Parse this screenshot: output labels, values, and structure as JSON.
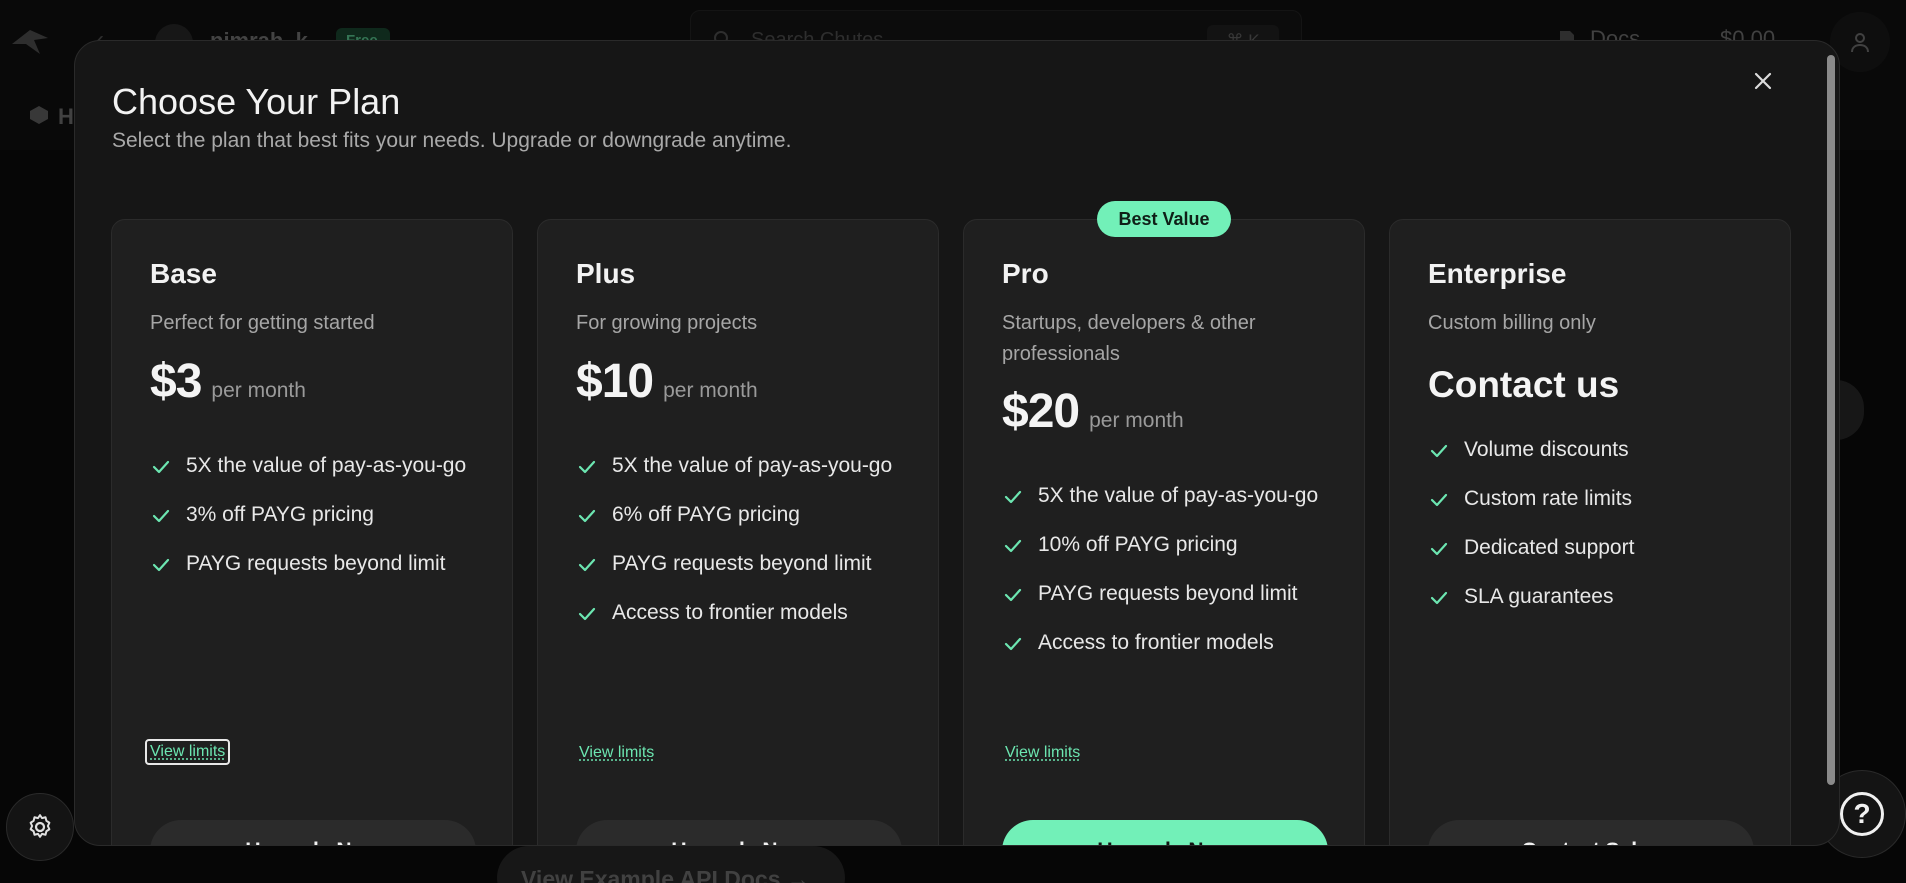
{
  "background": {
    "username": "nimrah_k",
    "plan_badge": "Free",
    "search_placeholder": "Search Chutes",
    "search_shortcut": "⌘ K",
    "docs_label": "Docs",
    "balance": "$0.00",
    "nav_label": "H",
    "bottom_button": "View Example API Docs →"
  },
  "modal": {
    "title": "Choose Your Plan",
    "subtitle": "Select the plan that best fits your needs. Upgrade or downgrade anytime.",
    "close_icon": "close-icon"
  },
  "badge": {
    "best_value": "Best Value"
  },
  "plans": [
    {
      "name": "Base",
      "description": "Perfect for getting started",
      "price": "$3",
      "period": "per month",
      "features": [
        "5X the value of pay-as-you-go",
        "3% off PAYG pricing",
        "PAYG requests beyond limit"
      ],
      "view_limits": "View limits",
      "cta": "Upgrade Now"
    },
    {
      "name": "Plus",
      "description": "For growing projects",
      "price": "$10",
      "period": "per month",
      "features": [
        "5X the value of pay-as-you-go",
        "6% off PAYG pricing",
        "PAYG requests beyond limit",
        "Access to frontier models"
      ],
      "view_limits": "View limits",
      "cta": "Upgrade Now"
    },
    {
      "name": "Pro",
      "description": "Startups, developers & other professionals",
      "price": "$20",
      "period": "per month",
      "features": [
        "5X the value of pay-as-you-go",
        "10% off PAYG pricing",
        "PAYG requests beyond limit",
        "Access to frontier models"
      ],
      "view_limits": "View limits",
      "cta": "Upgrade Now"
    },
    {
      "name": "Enterprise",
      "description": "Custom billing only",
      "price": "Contact us",
      "features": [
        "Volume discounts",
        "Custom rate limits",
        "Dedicated support",
        "SLA guarantees"
      ],
      "cta": "Contact Sales"
    }
  ],
  "colors": {
    "accent": "#72f0b8",
    "modal_bg": "#161616",
    "card_bg": "#1f1f1f"
  }
}
